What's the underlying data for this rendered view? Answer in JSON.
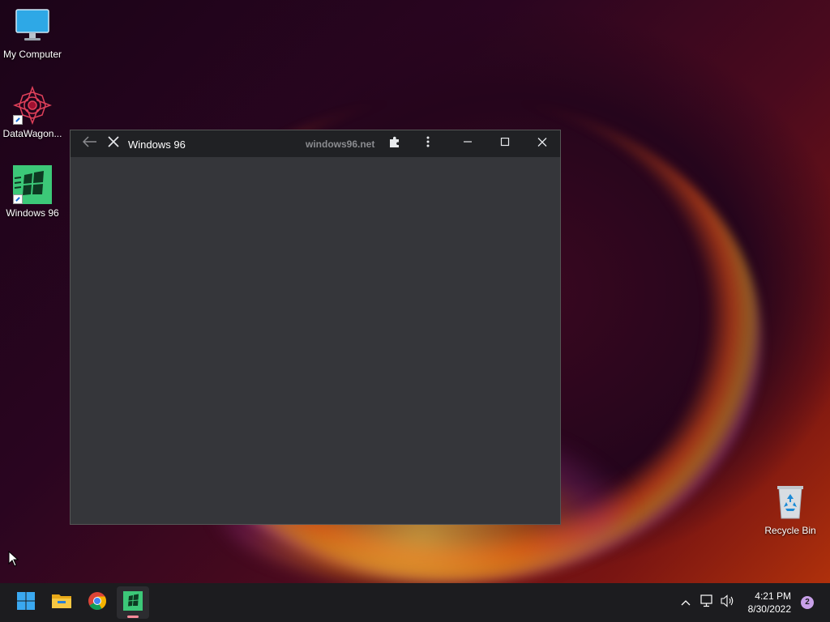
{
  "desktop": {
    "icons": [
      {
        "label": "My Computer",
        "icon": "monitor-icon"
      },
      {
        "label": "DataWagon...",
        "icon": "datawagon-icon"
      },
      {
        "label": "Windows 96",
        "icon": "windows96-icon"
      },
      {
        "label": "Recycle Bin",
        "icon": "recycle-bin-icon"
      }
    ]
  },
  "window": {
    "title": "Windows 96",
    "url": "windows96.net"
  },
  "taskbar": {
    "apps": [
      {
        "name": "start",
        "icon": "windows-start-icon"
      },
      {
        "name": "file-explorer",
        "icon": "folder-icon"
      },
      {
        "name": "chrome",
        "icon": "chrome-icon"
      },
      {
        "name": "windows96",
        "icon": "windows96-icon"
      }
    ],
    "time": "4:21 PM",
    "date": "8/30/2022",
    "notifications": "2"
  },
  "colors": {
    "taskbar": "#1c1c1f",
    "titlebar": "#202124",
    "window_body": "#35363a"
  }
}
